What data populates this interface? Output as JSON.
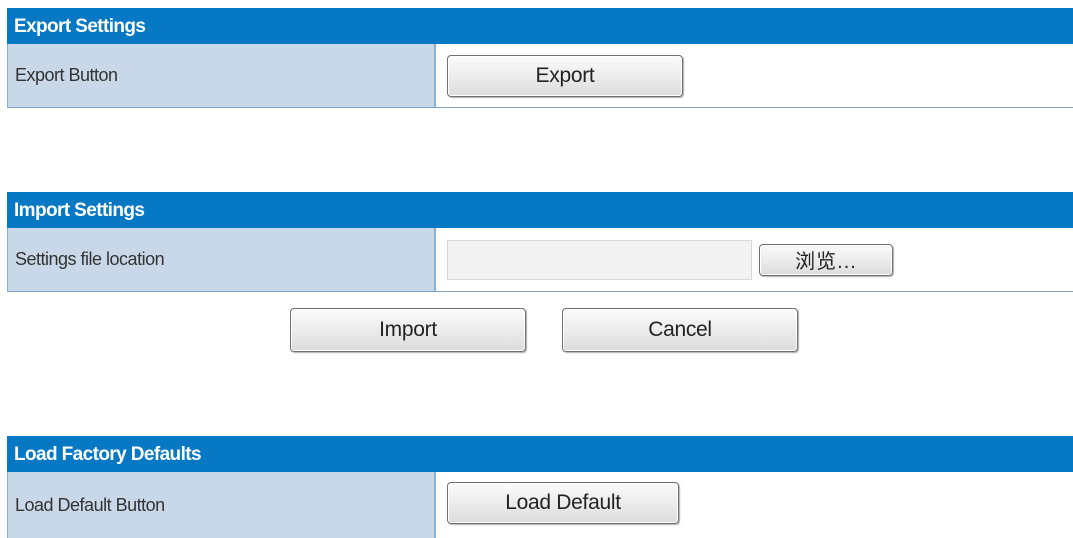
{
  "export_section": {
    "header": "Export Settings",
    "row_label": "Export Button",
    "button_label": "Export"
  },
  "import_section": {
    "header": "Import Settings",
    "row_label": "Settings file location",
    "file_value": "",
    "browse_label": "浏览...",
    "import_label": "Import",
    "cancel_label": "Cancel"
  },
  "defaults_section": {
    "header": "Load Factory Defaults",
    "row_label": "Load Default Button",
    "button_label": "Load Default"
  },
  "colors": {
    "header_bg": "#0779c4",
    "label_bg": "#c8d8e8"
  }
}
